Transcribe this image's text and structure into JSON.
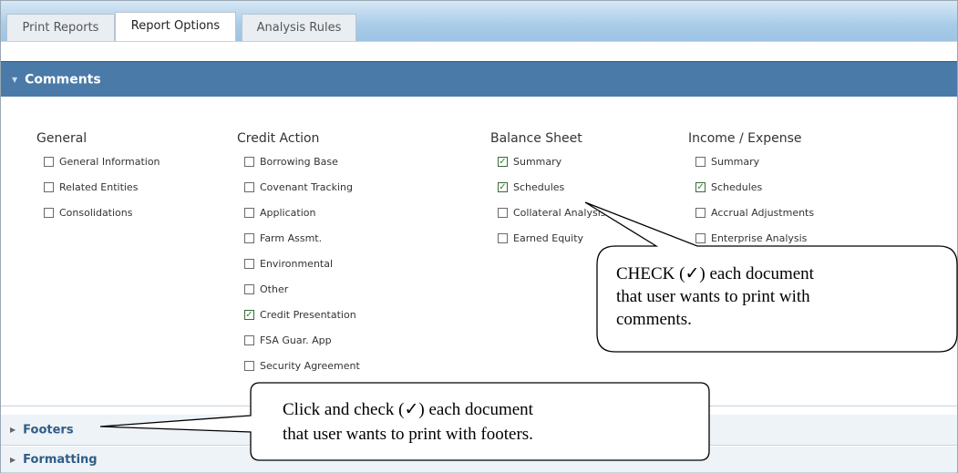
{
  "tabs": [
    {
      "label": "Print Reports",
      "active": false
    },
    {
      "label": "Report Options",
      "active": true
    },
    {
      "label": "Analysis Rules",
      "active": false
    }
  ],
  "sections": {
    "comments": "Comments",
    "footers": "Footers",
    "formatting": "Formatting"
  },
  "columns": [
    {
      "title": "General",
      "items": [
        {
          "label": "General Information",
          "checked": false
        },
        {
          "label": "Related Entities",
          "checked": false
        },
        {
          "label": "Consolidations",
          "checked": false
        }
      ]
    },
    {
      "title": "Credit Action",
      "items": [
        {
          "label": "Borrowing Base",
          "checked": false
        },
        {
          "label": "Covenant Tracking",
          "checked": false
        },
        {
          "label": "Application",
          "checked": false
        },
        {
          "label": "Farm Assmt.",
          "checked": false
        },
        {
          "label": "Environmental",
          "checked": false
        },
        {
          "label": "Other",
          "checked": false
        },
        {
          "label": "Credit Presentation",
          "checked": true
        },
        {
          "label": "FSA Guar. App",
          "checked": false
        },
        {
          "label": "Security Agreement",
          "checked": false
        }
      ]
    },
    {
      "title": "Balance Sheet",
      "items": [
        {
          "label": "Summary",
          "checked": true
        },
        {
          "label": "Schedules",
          "checked": true
        },
        {
          "label": "Collateral Analysis",
          "checked": false
        },
        {
          "label": "Earned Equity",
          "checked": false
        }
      ]
    },
    {
      "title": "Income / Expense",
      "items": [
        {
          "label": "Summary",
          "checked": false
        },
        {
          "label": "Schedules",
          "checked": true
        },
        {
          "label": "Accrual Adjustments",
          "checked": false
        },
        {
          "label": "Enterprise Analysis",
          "checked": false
        }
      ]
    }
  ],
  "callouts": {
    "comments_line1": "CHECK (✓) each document",
    "comments_line2": "that user wants to print with",
    "comments_line3": "comments.",
    "footers_line1": "Click and check (✓) each document",
    "footers_line2": "that user wants to print with footers."
  },
  "icons": {
    "expanded_arrow": "triangle-down-icon",
    "collapsed_arrow": "triangle-right-icon",
    "checkmark": "checkmark-icon"
  }
}
